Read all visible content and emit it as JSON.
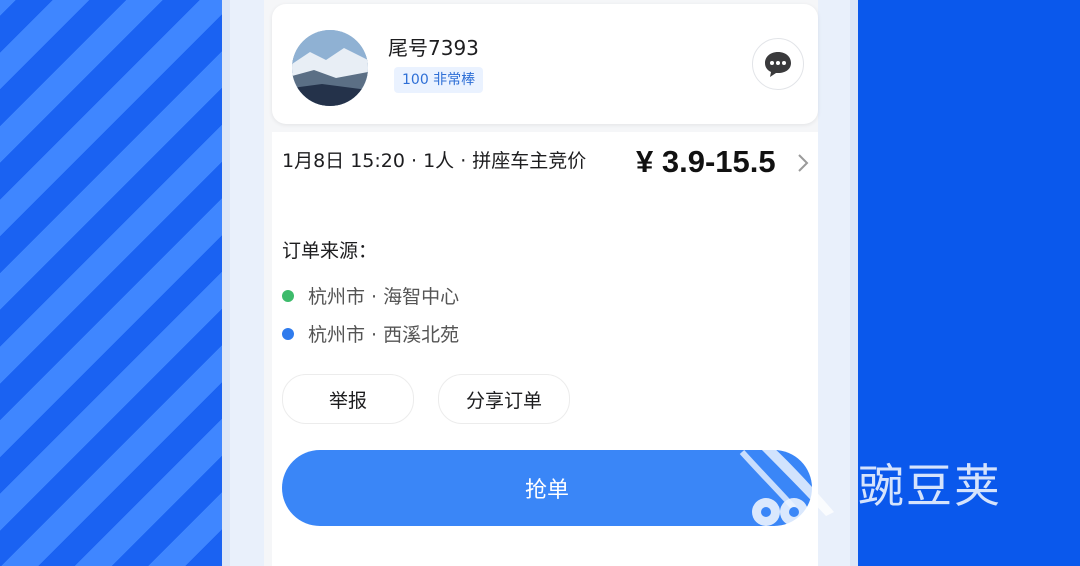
{
  "driver": {
    "name": "尾号7393",
    "rating": "100 非常棒"
  },
  "order": {
    "trip_info": "1月8日 15:20 · 1人 · 拼座车主竞价",
    "price": "¥ 3.9-15.5",
    "source_title": "订单来源：",
    "routes": [
      {
        "label": "杭州市 · 海智中心",
        "color": "#3dbb6b"
      },
      {
        "label": "杭州市 · 西溪北苑",
        "color": "#2f7bed"
      }
    ]
  },
  "actions": {
    "report": "举报",
    "share": "分享订单",
    "grab": "抢单"
  },
  "watermark": {
    "text": "豌豆荚"
  },
  "icons": {
    "chat": "chat-bubble-icon",
    "arrow": "chevron-right-icon"
  }
}
